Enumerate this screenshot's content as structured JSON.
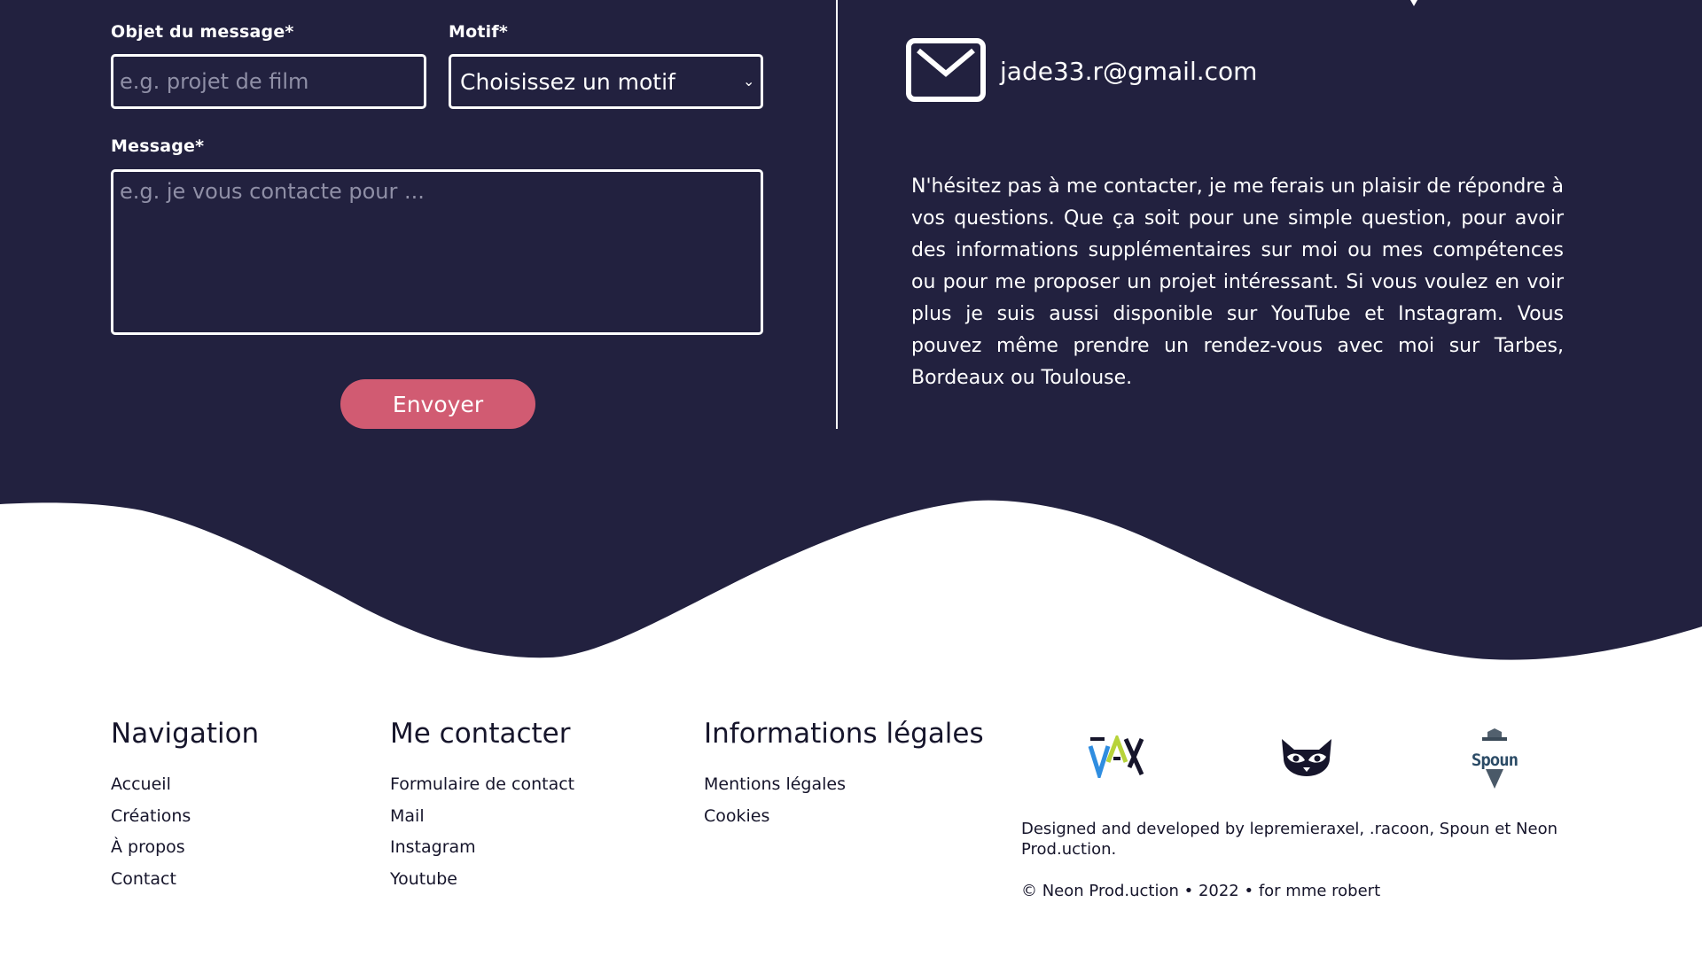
{
  "form": {
    "subject_label": "Objet du message*",
    "subject_placeholder": "e.g. projet de film",
    "motif_label": "Motif*",
    "motif_selected": "Choisissez un motif",
    "message_label": "Message*",
    "message_placeholder": "e.g. je vous contacte pour ...",
    "send_label": "Envoyer"
  },
  "contact": {
    "icon": "mail-icon",
    "email": "jade33.r@gmail.com",
    "about": "N'hésitez pas à me contacter, je me ferais un plaisir de répondre à vos questions. Que ça soit pour une simple question, pour avoir des informations supplémentaires sur moi ou mes compétences ou pour me proposer un projet intéressant. Si vous voulez en voir plus je suis aussi disponible sur YouTube et Instagram. Vous pouvez même prendre un rendez-vous avec moi sur Tarbes, Bordeaux ou Toulouse."
  },
  "footer": {
    "navigation": {
      "title": "Navigation",
      "items": [
        "Accueil",
        "Créations",
        "À propos",
        "Contact"
      ]
    },
    "contact": {
      "title": "Me contacter",
      "items": [
        "Formulaire de contact",
        "Mail",
        "Instagram",
        "Youtube"
      ]
    },
    "legal": {
      "title": "Informations légales",
      "items": [
        "Mentions légales",
        "Cookies"
      ]
    },
    "logos": {
      "logo_1_text": "AX",
      "logo_2_icon": "raccoon-icon",
      "logo_3_text": "Spoun"
    },
    "credits": "Designed and developed by lepremieraxel, .racoon, Spoun et Neon Prod.uction.",
    "copyright": "© Neon Prod.uction • 2022 • for mme robert"
  },
  "colors": {
    "dark_navy": "#22213f",
    "accent_pink": "#d15b72",
    "footer_text": "#16152b",
    "white": "#ffffff"
  }
}
